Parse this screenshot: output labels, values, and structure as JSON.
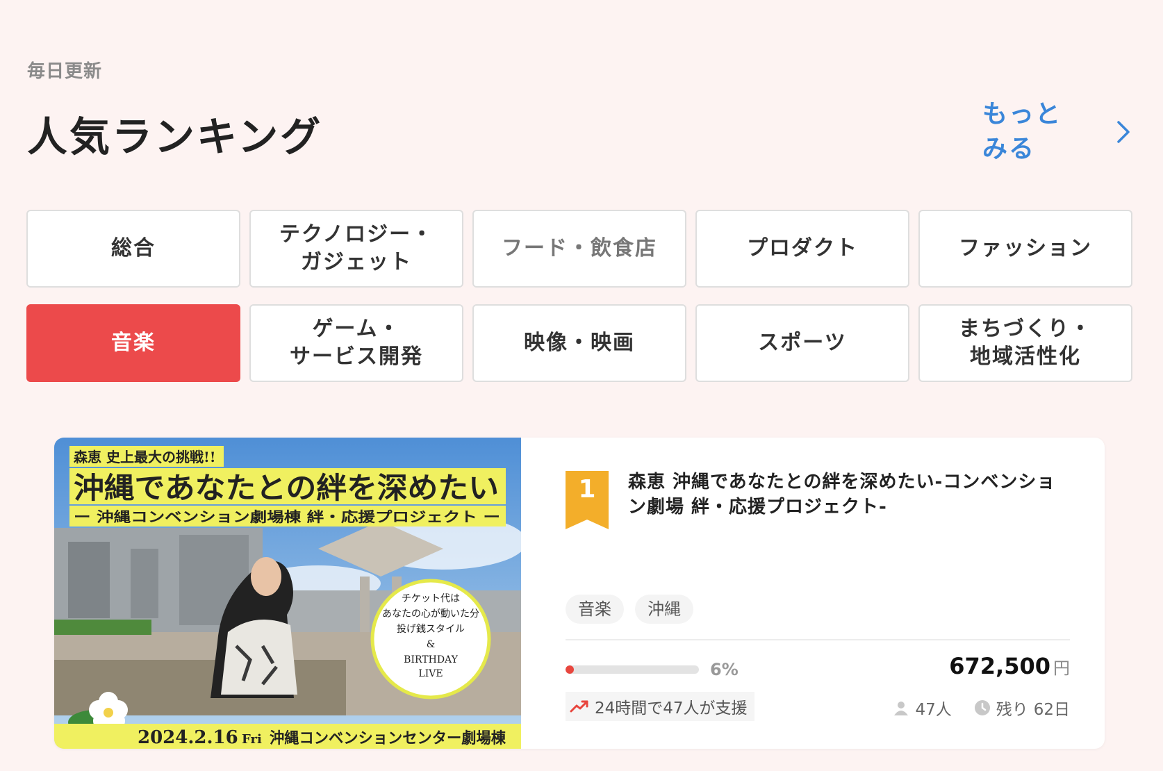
{
  "header": {
    "subtitle": "毎日更新",
    "title": "人気ランキング",
    "more_label": "もっとみる"
  },
  "categories": [
    {
      "label": "総合"
    },
    {
      "label": "テクノロジー・\nガジェット"
    },
    {
      "label": "フード・飲食店"
    },
    {
      "label": "プロダクト"
    },
    {
      "label": "ファッション"
    },
    {
      "label": "音楽"
    },
    {
      "label": "ゲーム・\nサービス開発"
    },
    {
      "label": "映像・映画"
    },
    {
      "label": "スポーツ"
    },
    {
      "label": "まちづくり・\n地域活性化"
    }
  ],
  "active_category": "音楽",
  "project": {
    "rank": "1",
    "title": "森恵 沖縄であなたとの絆を深めたい-コンベンション劇場 絆・応援プロジェクト-",
    "tags": [
      "音楽",
      "沖縄"
    ],
    "progress_percent": 6,
    "progress_label": "6%",
    "amount": "672,500",
    "currency": "円",
    "trend_text": "24時間で47人が支援",
    "supporters": "47人",
    "remaining_prefix": "残り",
    "remaining_days": "62日",
    "image": {
      "tagline": "森恵 史上最大の挑戦!!",
      "headline": "沖縄であなたとの絆を深めたい",
      "subline": "ー 沖縄コンベンション劇場棟 絆・応援プロジェクト ー",
      "circle_line1": "チケット代は",
      "circle_line2": "あなたの心が動いた分",
      "circle_line3": "投げ銭スタイル",
      "circle_line4": "&",
      "circle_line5": "BIRTHDAY",
      "circle_line6": "LIVE",
      "date": "2024.2.16",
      "day": "Fri",
      "venue": "沖縄コンベンションセンター劇場棟"
    }
  },
  "colors": {
    "background": "#fdf3f2",
    "accent_red": "#ec4a4b",
    "link_blue": "#3a86d9",
    "rank_gold": "#f3ae2a"
  }
}
